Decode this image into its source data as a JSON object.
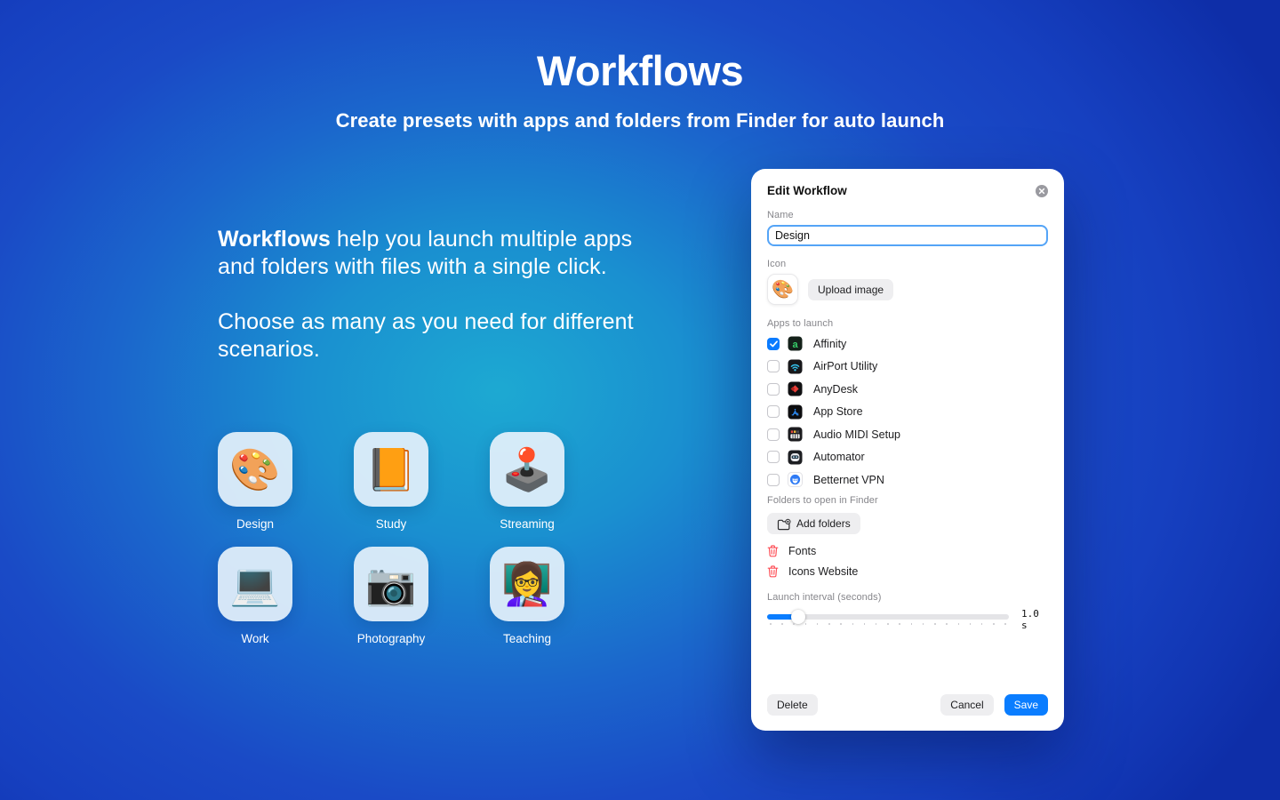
{
  "header": {
    "title": "Workflows",
    "subtitle": "Create presets with apps and folders from Finder for auto launch"
  },
  "intro": {
    "lead_bold": "Workflows",
    "lead_rest": " help you launch multiple apps and folders with files with a single click.",
    "second": "Choose as many as you need for different scenarios."
  },
  "presets": [
    {
      "label": "Design",
      "emoji": "🎨",
      "icon_name": "palette-emoji-icon"
    },
    {
      "label": "Study",
      "emoji": "📙",
      "icon_name": "book-emoji-icon"
    },
    {
      "label": "Streaming",
      "emoji": "🕹️",
      "icon_name": "joystick-emoji-icon"
    },
    {
      "label": "Work",
      "emoji": "💻",
      "icon_name": "laptop-emoji-icon"
    },
    {
      "label": "Photography",
      "emoji": "📷",
      "icon_name": "camera-emoji-icon"
    },
    {
      "label": "Teaching",
      "emoji": "👩‍🏫",
      "icon_name": "teacher-emoji-icon"
    }
  ],
  "dialog": {
    "title": "Edit Workflow",
    "name_label": "Name",
    "name_value": "Design",
    "icon_label": "Icon",
    "icon_emoji": "🎨",
    "upload_button": "Upload image",
    "apps_label": "Apps to launch",
    "apps": [
      {
        "name": "Affinity",
        "checked": true,
        "icon": "affinity"
      },
      {
        "name": "AirPort Utility",
        "checked": false,
        "icon": "airport-utility"
      },
      {
        "name": "AnyDesk",
        "checked": false,
        "icon": "anydesk"
      },
      {
        "name": "App Store",
        "checked": false,
        "icon": "app-store"
      },
      {
        "name": "Audio MIDI Setup",
        "checked": false,
        "icon": "audio-midi-setup"
      },
      {
        "name": "Automator",
        "checked": false,
        "icon": "automator"
      },
      {
        "name": "Betternet VPN",
        "checked": false,
        "icon": "betternet-vpn"
      }
    ],
    "folders_label": "Folders to open in Finder",
    "add_folders_button": "Add folders",
    "folders": [
      "Fonts",
      "Icons Website"
    ],
    "interval_label": "Launch interval (seconds)",
    "interval_value": "1.0",
    "interval_unit": "s",
    "delete_button": "Delete",
    "cancel_button": "Cancel",
    "save_button": "Save",
    "accent_color": "#0a7bff",
    "danger_color": "#fd4f57"
  }
}
